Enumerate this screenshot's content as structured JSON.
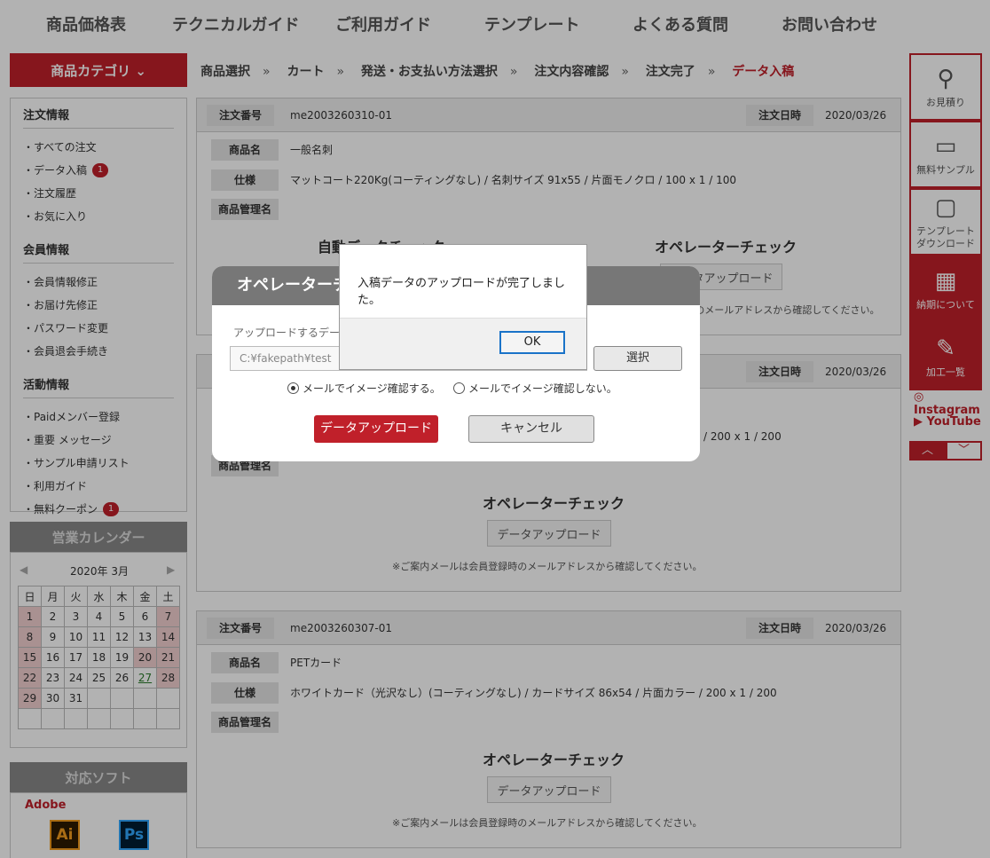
{
  "topnav": [
    "商品価格表",
    "テクニカルガイド",
    "ご利用ガイド",
    "テンプレート",
    "よくある質問",
    "お問い合わせ"
  ],
  "category_button": "商品カテゴリ ⌄",
  "sidebar": {
    "order_head": "注文情報",
    "order_items": [
      "・すべての注文",
      "・データ入稿",
      "・注文履歴",
      "・お気に入り"
    ],
    "data_badge": "1",
    "member_head": "会員情報",
    "member_items": [
      "・会員情報修正",
      "・お届け先修正",
      "・パスワード変更",
      "・会員退会手続き"
    ],
    "activity_head": "活動情報",
    "activity_items": [
      "・Paidメンバー登録",
      "・重要 メッセージ",
      "・サンプル申請リスト",
      "・利用ガイド",
      "・無料クーポン"
    ],
    "coupon_badge": "1"
  },
  "calendar": {
    "head": "営業カレンダー",
    "month": "2020年 3月",
    "prev": "◀",
    "next": "▶",
    "weekdays": [
      "日",
      "月",
      "火",
      "水",
      "木",
      "金",
      "土"
    ],
    "rows": [
      [
        "1",
        "2",
        "3",
        "4",
        "5",
        "6",
        "7"
      ],
      [
        "8",
        "9",
        "10",
        "11",
        "12",
        "13",
        "14"
      ],
      [
        "15",
        "16",
        "17",
        "18",
        "19",
        "20",
        "21"
      ],
      [
        "22",
        "23",
        "24",
        "25",
        "26",
        "27",
        "28"
      ],
      [
        "29",
        "30",
        "31",
        "",
        "",
        "",
        ""
      ],
      [
        "",
        "",
        "",
        "",
        "",
        "",
        ""
      ]
    ]
  },
  "software": {
    "head": "対応ソフト",
    "adobe": "Adobe",
    "ai": "Ai",
    "ps": "Ps"
  },
  "breadcrumb": {
    "steps": [
      "商品選択",
      "カート",
      "発送・お支払い方法選択",
      "注文内容確認",
      "注文完了",
      "データ入稿"
    ],
    "separator": "»"
  },
  "orders": [
    {
      "order_no_label": "注文番号",
      "order_no": "me2003260310-01",
      "date_label": "注文日時",
      "date": "2020/03/26",
      "product_label": "商品名",
      "product": "一般名刺",
      "spec_label": "仕様",
      "spec": "マットコート220Kg(コーティングなし) / 名刺サイズ 91x55 / 片面モノクロ / 100 x 1 / 100",
      "mgmt_label": "商品管理名",
      "auto_check": "自動データチェック",
      "op_check": "オペレーターチェック",
      "upload_btn": "データアップロード",
      "note": "※ご案内メールは会員登録時のメールアドレスから確認してください。"
    },
    {
      "date_label": "注文日時",
      "date": "2020/03/26",
      "spec_tail": "/ 200 x 1 / 200",
      "mgmt_label": "商品管理名",
      "op_check": "オペレーターチェック",
      "upload_btn": "データアップロード",
      "note": "※ご案内メールは会員登録時のメールアドレスから確認してください。"
    },
    {
      "order_no_label": "注文番号",
      "order_no": "me2003260307-01",
      "date_label": "注文日時",
      "date": "2020/03/26",
      "product_label": "商品名",
      "product": "PETカード",
      "spec_label": "仕様",
      "spec": "ホワイトカード（光沢なし）(コーティングなし) / カードサイズ 86x54 / 片面カラー / 200 x 1 / 200",
      "mgmt_label": "商品管理名",
      "op_check": "オペレーターチェック",
      "upload_btn": "データアップロード",
      "note": "※ご案内メールは会員登録時のメールアドレスから確認してください。"
    }
  ],
  "right_menu": {
    "estimate": "お見積り",
    "sample": "無料サンプル",
    "template": "テンプレート\nダウンロード",
    "delivery": "納期について",
    "processing": "加工一覧",
    "instagram": "Instagram",
    "youtube": "YouTube"
  },
  "modal": {
    "title": "オペレーターチ",
    "file_label": "アップロードするデー",
    "file_value": "C:¥fakepath¥test",
    "select_btn": "選択",
    "radio_yes": "メールでイメージ確認する。",
    "radio_no": "メールでイメージ確認しない。",
    "upload_btn": "データアップロード",
    "cancel_btn": "キャンセル"
  },
  "alert": {
    "message": "入稿データのアップロードが完了しました。",
    "ok": "OK"
  },
  "colors": {
    "accent": "#c0202a"
  }
}
